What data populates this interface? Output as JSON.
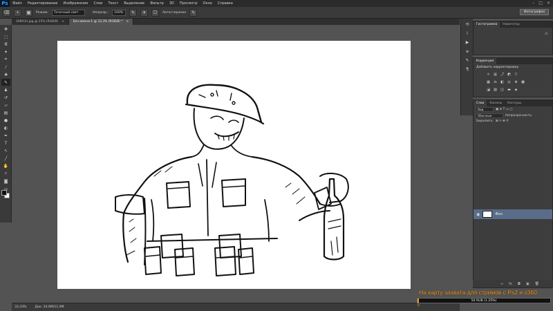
{
  "app": {
    "logo": "Ps"
  },
  "menu": [
    "Файл",
    "Редактирование",
    "Изображение",
    "Слои",
    "Текст",
    "Выделение",
    "Фильтр",
    "3D",
    "Просмотр",
    "Окно",
    "Справка"
  ],
  "window_controls": [
    "–",
    "□",
    "×"
  ],
  "options_bar": {
    "mode_label": "Режим:",
    "mode_value": "Точечный свет",
    "opacity_label": "Непрозр.:",
    "opacity_value": "100%",
    "auto_label": "Автостирание",
    "workspace": "Фотография"
  },
  "document_tabs": [
    {
      "label": "3ABA31.jpg @ 25% (RGB/8)",
      "close": "×",
      "active": false
    },
    {
      "label": "Без имени-1 @ 33,3% (RGB/8) *",
      "close": "×",
      "active": true
    }
  ],
  "status": {
    "zoom": "33,33%",
    "doc": "Док: 24,9M/11,9M"
  },
  "panels": {
    "top_tabs": [
      "Гистограмма",
      "Навигатор"
    ],
    "corrections_tab": "Коррекция",
    "corrections_title": "Добавить корректировку",
    "layers_tabs": [
      "Слои",
      "Каналы",
      "Контуры"
    ],
    "kind_label": "Вид",
    "blend_mode": "Обычные",
    "opacity_label": "Непрозрачность:",
    "lock_label": "Закрепить:",
    "layer_name": "Фон"
  },
  "overlay": {
    "caption": "На карту захвата для стримов с Ps2 и x360",
    "progress_label": "50 RUB (1.25%)",
    "progress_fraction": 0.0125,
    "scale_min": "0",
    "color": "#ff9b22"
  },
  "colors": {
    "accent": "#ff9b22",
    "layer_selected": "#596c89",
    "bg": "#535353"
  }
}
